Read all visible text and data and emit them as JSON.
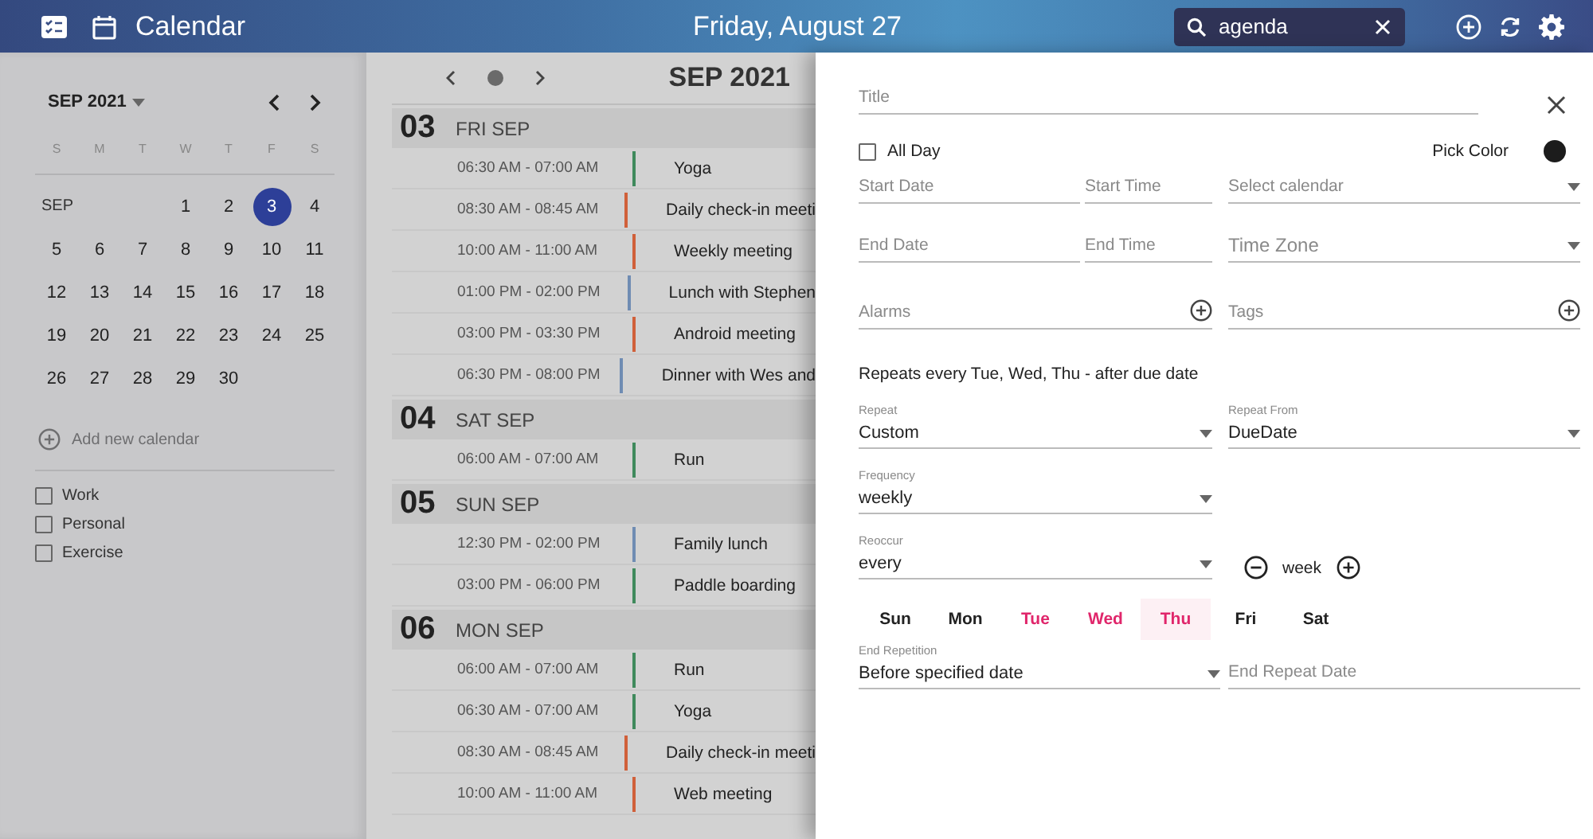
{
  "top_bar": {
    "title": "Calendar",
    "date": "Friday, August 27",
    "search": {
      "value": "agenda"
    }
  },
  "sidebar": {
    "month": "SEP 2021",
    "weekdays": [
      "S",
      "M",
      "T",
      "W",
      "T",
      "F",
      "S"
    ],
    "weeks": [
      [
        {
          "kind": "label",
          "text": "SEP"
        },
        {
          "kind": "blank"
        },
        {
          "kind": "blank"
        },
        {
          "kind": "day",
          "text": "1",
          "selected": false
        },
        {
          "kind": "day",
          "text": "2",
          "selected": false
        },
        {
          "kind": "day",
          "text": "3",
          "selected": true
        },
        {
          "kind": "day",
          "text": "4",
          "selected": false
        }
      ],
      [
        {
          "kind": "day",
          "text": "5",
          "selected": false
        },
        {
          "kind": "day",
          "text": "6",
          "selected": false
        },
        {
          "kind": "day",
          "text": "7",
          "selected": false
        },
        {
          "kind": "day",
          "text": "8",
          "selected": false
        },
        {
          "kind": "day",
          "text": "9",
          "selected": false
        },
        {
          "kind": "day",
          "text": "10",
          "selected": false
        },
        {
          "kind": "day",
          "text": "11",
          "selected": false
        }
      ],
      [
        {
          "kind": "day",
          "text": "12",
          "selected": false
        },
        {
          "kind": "day",
          "text": "13",
          "selected": false
        },
        {
          "kind": "day",
          "text": "14",
          "selected": false
        },
        {
          "kind": "day",
          "text": "15",
          "selected": false
        },
        {
          "kind": "day",
          "text": "16",
          "selected": false
        },
        {
          "kind": "day",
          "text": "17",
          "selected": false
        },
        {
          "kind": "day",
          "text": "18",
          "selected": false
        }
      ],
      [
        {
          "kind": "day",
          "text": "19",
          "selected": false
        },
        {
          "kind": "day",
          "text": "20",
          "selected": false
        },
        {
          "kind": "day",
          "text": "21",
          "selected": false
        },
        {
          "kind": "day",
          "text": "22",
          "selected": false
        },
        {
          "kind": "day",
          "text": "23",
          "selected": false
        },
        {
          "kind": "day",
          "text": "24",
          "selected": false
        },
        {
          "kind": "day",
          "text": "25",
          "selected": false
        }
      ],
      [
        {
          "kind": "day",
          "text": "26",
          "selected": false
        },
        {
          "kind": "day",
          "text": "27",
          "selected": false
        },
        {
          "kind": "day",
          "text": "28",
          "selected": false
        },
        {
          "kind": "day",
          "text": "29",
          "selected": false
        },
        {
          "kind": "day",
          "text": "30",
          "selected": false
        },
        {
          "kind": "blank"
        },
        {
          "kind": "blank"
        }
      ]
    ],
    "add_calendar": "Add new calendar",
    "calendars": [
      {
        "label": "Work",
        "checked": false
      },
      {
        "label": "Personal",
        "checked": false
      },
      {
        "label": "Exercise",
        "checked": false
      }
    ]
  },
  "agenda": {
    "title": "SEP 2021",
    "days": [
      {
        "number": "03",
        "label": "FRI SEP",
        "events": [
          {
            "time": "06:30 AM - 07:00 AM",
            "title": "Yoga",
            "color": "#3f8a5c"
          },
          {
            "time": "08:30 AM - 08:45 AM",
            "title": "Daily check-in meeti",
            "color": "#d0603a"
          },
          {
            "time": "10:00 AM - 11:00 AM",
            "title": "Weekly meeting",
            "color": "#d0603a"
          },
          {
            "time": "01:00 PM - 02:00 PM",
            "title": "Lunch with Stephen",
            "color": "#6f8cb3"
          },
          {
            "time": "03:00 PM - 03:30 PM",
            "title": "Android meeting",
            "color": "#d0603a"
          },
          {
            "time": "06:30 PM - 08:00 PM",
            "title": "Dinner with Wes and",
            "color": "#6f8cb3"
          }
        ]
      },
      {
        "number": "04",
        "label": "SAT SEP",
        "events": [
          {
            "time": "06:00 AM - 07:00 AM",
            "title": "Run",
            "color": "#3f8a5c"
          }
        ]
      },
      {
        "number": "05",
        "label": "SUN SEP",
        "events": [
          {
            "time": "12:30 PM - 02:00 PM",
            "title": "Family lunch",
            "color": "#6f8cb3"
          },
          {
            "time": "03:00 PM - 06:00 PM",
            "title": "Paddle boarding",
            "color": "#3f8a5c"
          }
        ]
      },
      {
        "number": "06",
        "label": "MON SEP",
        "events": [
          {
            "time": "06:00 AM - 07:00 AM",
            "title": "Run",
            "color": "#3f8a5c"
          },
          {
            "time": "06:30 AM - 07:00 AM",
            "title": "Yoga",
            "color": "#3f8a5c"
          },
          {
            "time": "08:30 AM - 08:45 AM",
            "title": "Daily check-in meeti",
            "color": "#d0603a"
          },
          {
            "time": "10:00 AM - 11:00 AM",
            "title": "Web meeting",
            "color": "#d0603a"
          }
        ]
      }
    ]
  },
  "event_form": {
    "title_field": {
      "placeholder": "Title"
    },
    "all_day": {
      "label": "All Day",
      "checked": false
    },
    "pick_color": {
      "label": "Pick Color",
      "color": "#1c1c1c"
    },
    "start_date": {
      "placeholder": "Start Date"
    },
    "start_time": {
      "placeholder": "Start Time"
    },
    "calendar": {
      "placeholder": "Select calendar"
    },
    "end_date": {
      "placeholder": "End Date"
    },
    "end_time": {
      "placeholder": "End Time"
    },
    "time_zone": {
      "placeholder": "Time Zone"
    },
    "alarms": {
      "placeholder": "Alarms"
    },
    "tags": {
      "placeholder": "Tags"
    },
    "repeat_summary": "Repeats every Tue, Wed, Thu - after due date",
    "repeat": {
      "label": "Repeat",
      "value": "Custom"
    },
    "repeat_from": {
      "label": "Repeat From",
      "value": "DueDate"
    },
    "frequency": {
      "label": "Frequency",
      "value": "weekly"
    },
    "reoccur": {
      "label": "Reoccur",
      "value": "every"
    },
    "interval": {
      "unit": "week"
    },
    "weekdays": [
      {
        "label": "Sun",
        "selected": false,
        "highlighted": false
      },
      {
        "label": "Mon",
        "selected": false,
        "highlighted": false
      },
      {
        "label": "Tue",
        "selected": true,
        "highlighted": false
      },
      {
        "label": "Wed",
        "selected": true,
        "highlighted": false
      },
      {
        "label": "Thu",
        "selected": true,
        "highlighted": true
      },
      {
        "label": "Fri",
        "selected": false,
        "highlighted": false
      },
      {
        "label": "Sat",
        "selected": false,
        "highlighted": false
      }
    ],
    "end_repetition": {
      "label": "End Repetition",
      "value": "Before specified date"
    },
    "end_repeat_date": {
      "placeholder": "End Repeat Date"
    }
  }
}
